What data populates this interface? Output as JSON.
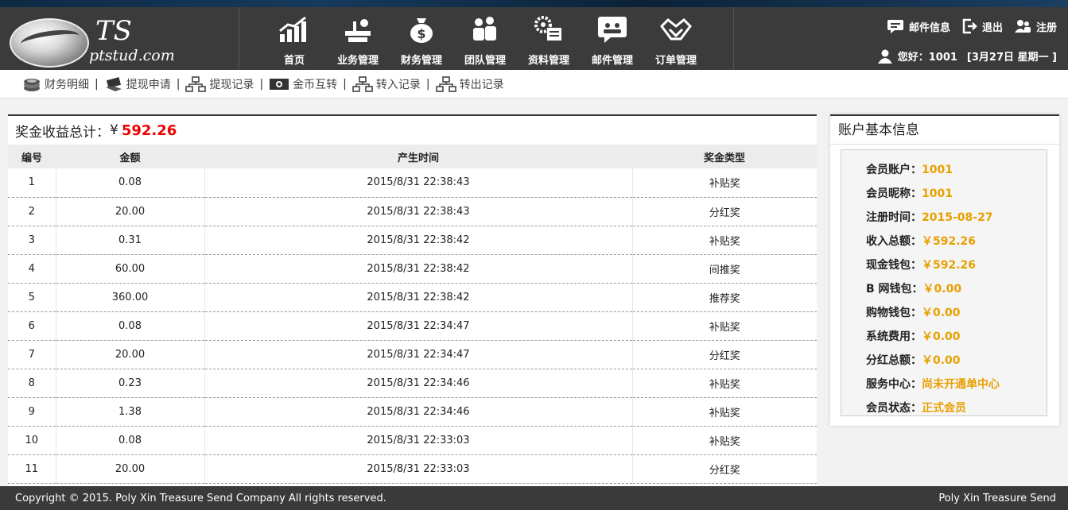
{
  "logo": {
    "title": "TS",
    "subtitle": "ptstud.com"
  },
  "nav": [
    {
      "label": "首页",
      "icon": "chart-icon"
    },
    {
      "label": "业务管理",
      "icon": "business-icon"
    },
    {
      "label": "财务管理",
      "icon": "money-bag-icon"
    },
    {
      "label": "团队管理",
      "icon": "team-icon"
    },
    {
      "label": "资料管理",
      "icon": "settings-doc-icon"
    },
    {
      "label": "邮件管理",
      "icon": "mail-chat-icon"
    },
    {
      "label": "订单管理",
      "icon": "handshake-icon"
    }
  ],
  "user_links": {
    "mail": "邮件信息",
    "logout": "退出",
    "register": "注册"
  },
  "greeting": "您好：1001",
  "date": "[3月27日 星期一 ]",
  "subnav": [
    {
      "label": "财务明细",
      "icon": "coins-icon"
    },
    {
      "label": "提现申请",
      "icon": "cash-hand-icon"
    },
    {
      "label": "提现记录",
      "icon": "sitemap-icon"
    },
    {
      "label": "金币互转",
      "icon": "banknote-icon"
    },
    {
      "label": "转入记录",
      "icon": "sitemap-icon"
    },
    {
      "label": "转出记录",
      "icon": "sitemap-icon"
    }
  ],
  "summary": {
    "label": "奖金收益总计：",
    "currency": "¥",
    "amount": "592.26"
  },
  "table": {
    "headers": [
      "编号",
      "金额",
      "产生时间",
      "奖金类型"
    ],
    "rows": [
      [
        "1",
        "0.08",
        "2015/8/31 22:38:43",
        "补贴奖"
      ],
      [
        "2",
        "20.00",
        "2015/8/31 22:38:43",
        "分红奖"
      ],
      [
        "3",
        "0.31",
        "2015/8/31 22:38:42",
        "补贴奖"
      ],
      [
        "4",
        "60.00",
        "2015/8/31 22:38:42",
        "间推奖"
      ],
      [
        "5",
        "360.00",
        "2015/8/31 22:38:42",
        "推荐奖"
      ],
      [
        "6",
        "0.08",
        "2015/8/31 22:34:47",
        "补贴奖"
      ],
      [
        "7",
        "20.00",
        "2015/8/31 22:34:47",
        "分红奖"
      ],
      [
        "8",
        "0.23",
        "2015/8/31 22:34:46",
        "补贴奖"
      ],
      [
        "9",
        "1.38",
        "2015/8/31 22:34:46",
        "补贴奖"
      ],
      [
        "10",
        "0.08",
        "2015/8/31 22:33:03",
        "补贴奖"
      ],
      [
        "11",
        "20.00",
        "2015/8/31 22:33:03",
        "分红奖"
      ]
    ]
  },
  "account": {
    "title": "账户基本信息",
    "rows": [
      {
        "key": "会员账户：",
        "value": "1001"
      },
      {
        "key": "会员昵称：",
        "value": "1001"
      },
      {
        "key": "注册时间：",
        "value": "2015-08-27"
      },
      {
        "key": "收入总额：",
        "value": "￥592.26"
      },
      {
        "key": "现金钱包：",
        "value": "￥592.26"
      },
      {
        "key": "B 网钱包：",
        "value": "￥0.00"
      },
      {
        "key": "购物钱包：",
        "value": "￥0.00"
      },
      {
        "key": "系统费用：",
        "value": "￥0.00"
      },
      {
        "key": "分红总额：",
        "value": "￥0.00"
      },
      {
        "key": "服务中心：",
        "value": "尚未开通单中心"
      },
      {
        "key": "会员状态：",
        "value": "正式会员"
      }
    ]
  },
  "footer": {
    "copyright": "Copyright © 2015. Poly Xin Treasure Send Company All rights reserved.",
    "brand": "Poly Xin Treasure Send"
  },
  "colors": {
    "header_bg": "#3b3b3b",
    "total_amount": "#ee0000",
    "info_value": "#e8a000"
  }
}
